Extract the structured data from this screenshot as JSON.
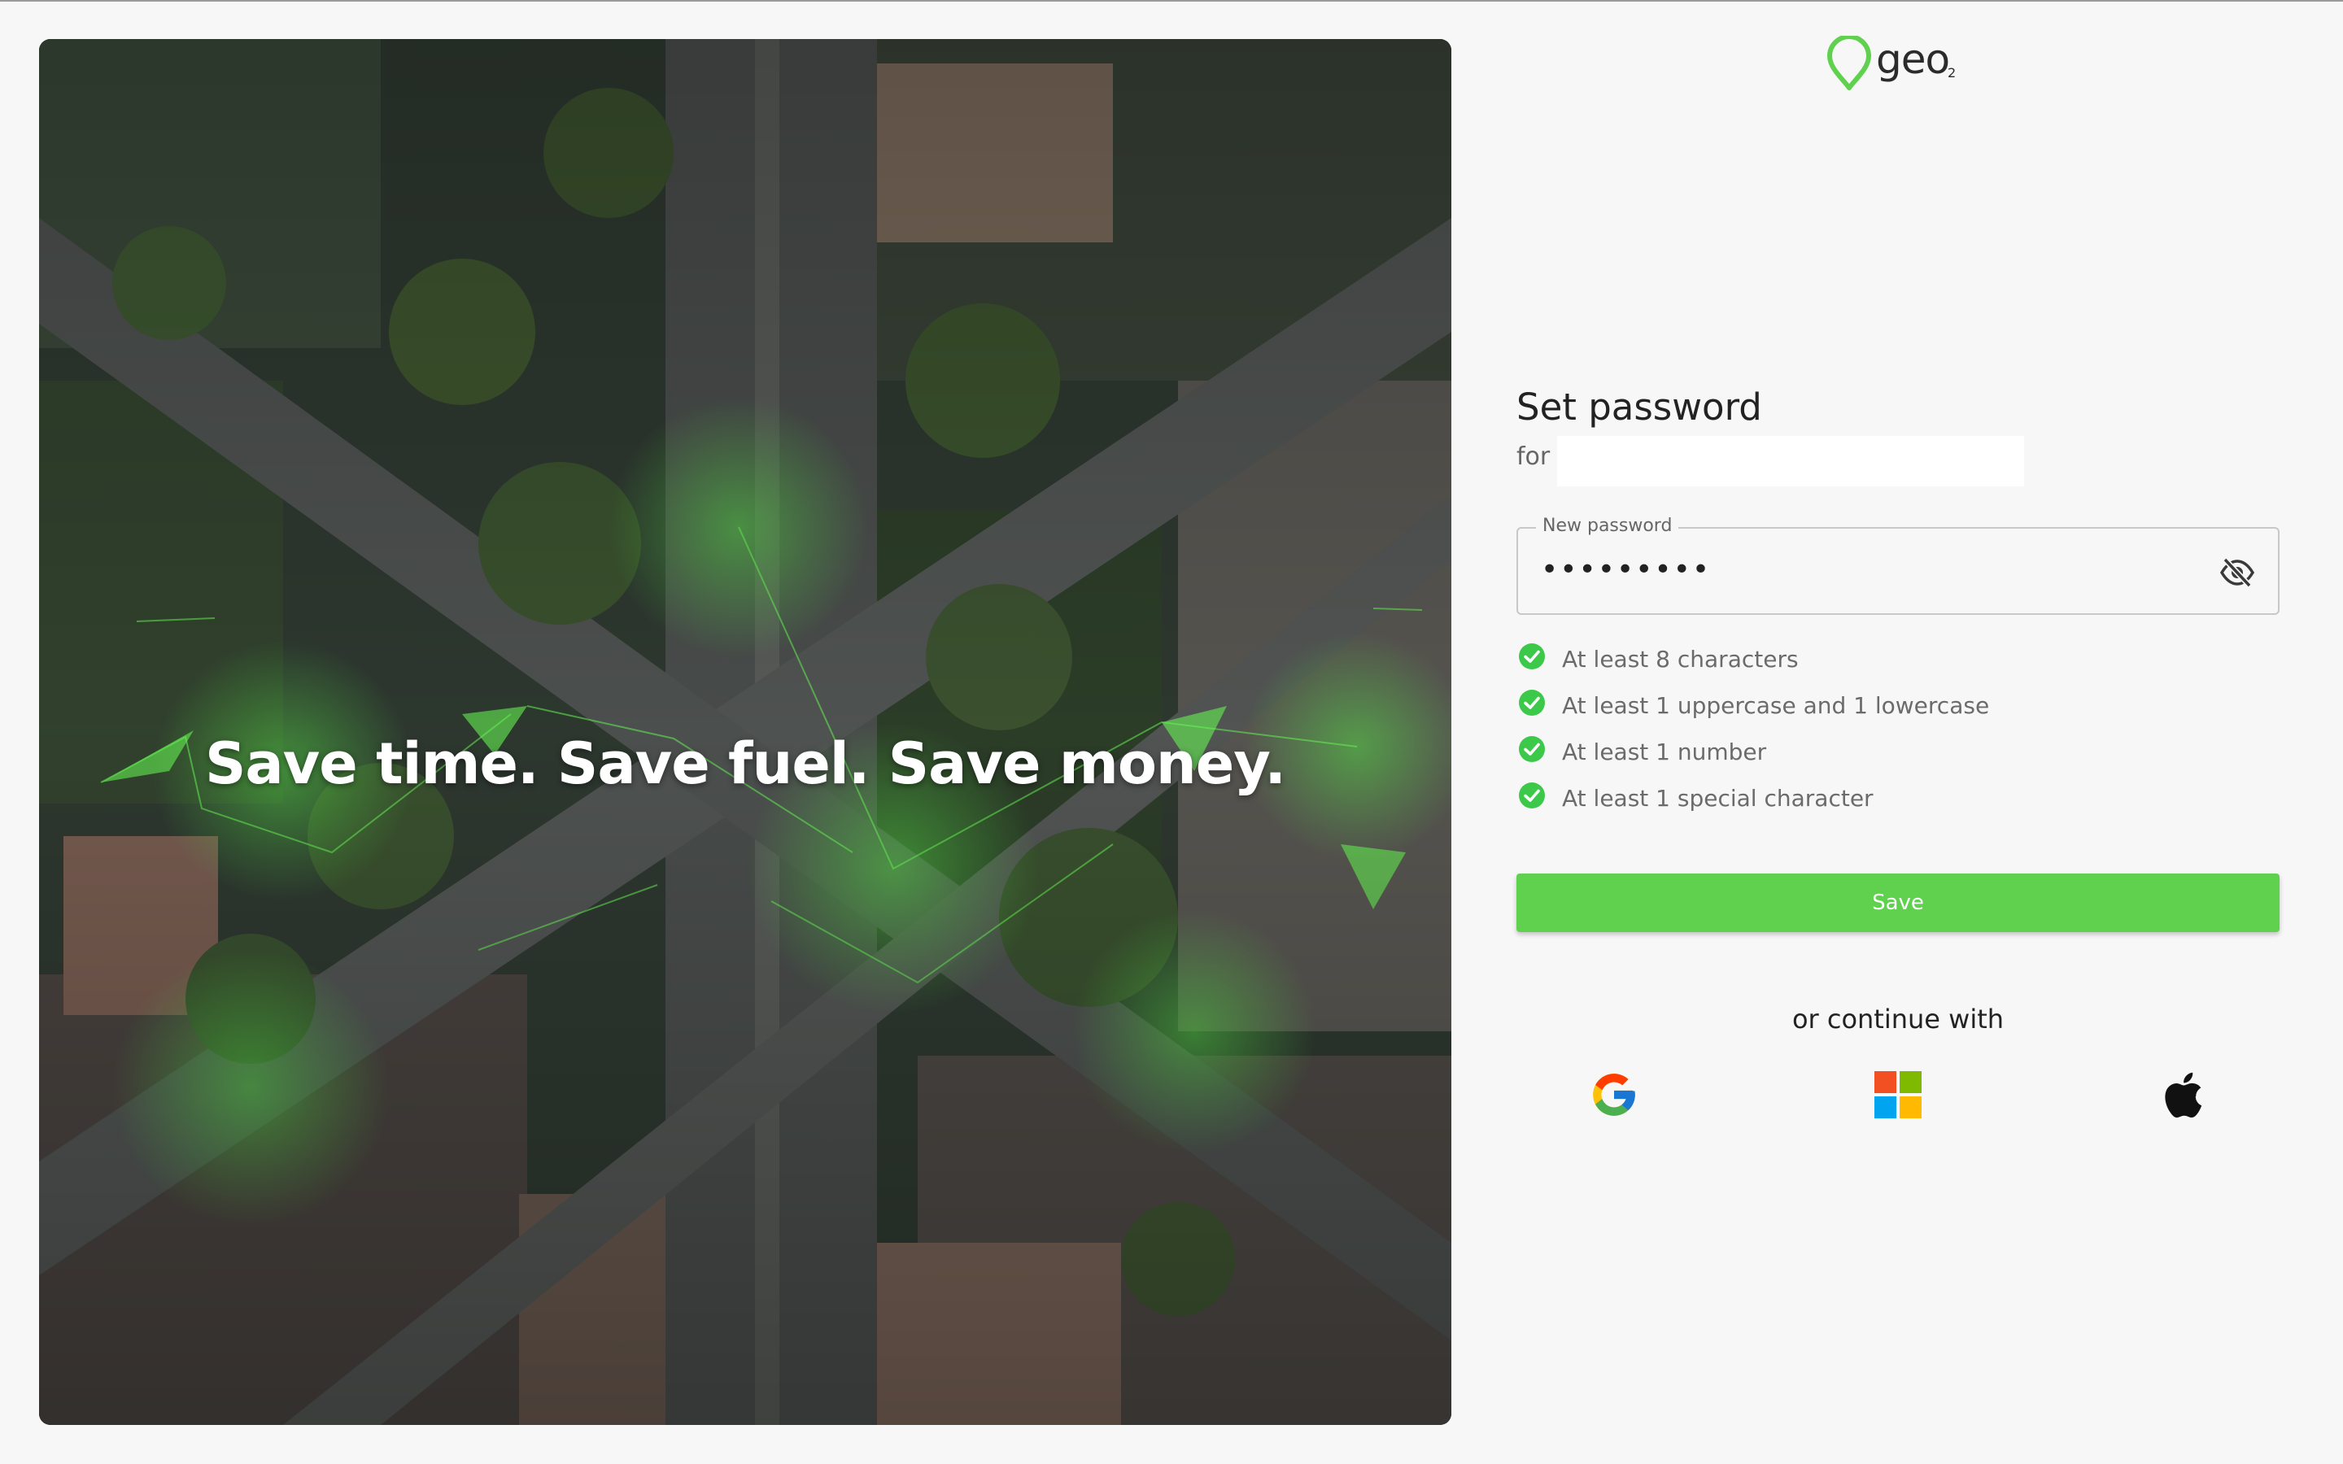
{
  "hero": {
    "tagline": "Save time. Save fuel. Save money."
  },
  "logo": {
    "text": "geo",
    "sub": "2"
  },
  "form": {
    "title": "Set password",
    "for_label": "for",
    "password_label": "New password",
    "password_value": "•••••••••",
    "rules": [
      "At least 8 characters",
      "At least 1 uppercase and 1 lowercase",
      "At least 1 number",
      "At least 1 special character"
    ],
    "save_label": "Save",
    "or_continue": "or continue with"
  },
  "icons": {
    "logo": "map-pin-icon",
    "password_toggle": "eye-off-icon",
    "rule_status": "check-circle-icon",
    "providers": [
      "google-icon",
      "microsoft-icon",
      "apple-icon"
    ]
  },
  "colors": {
    "brand_green": "#5fd14e",
    "check_green": "#3cc94a",
    "background": "#f7f7f7"
  }
}
